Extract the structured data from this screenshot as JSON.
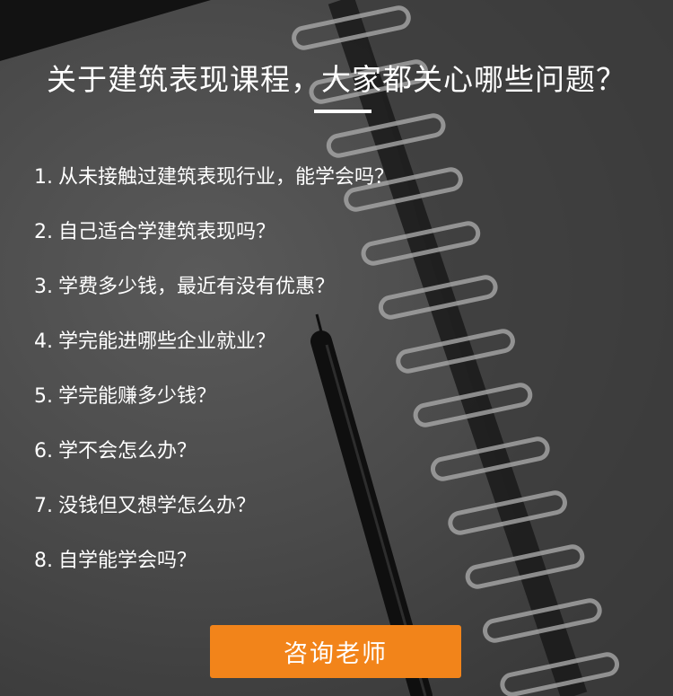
{
  "header": {
    "title": "关于建筑表现课程，大家都关心哪些问题？"
  },
  "faq": {
    "items": [
      {
        "num": "1.",
        "text": "从未接触过建筑表现行业，能学会吗？"
      },
      {
        "num": "2.",
        "text": "自己适合学建筑表现吗？"
      },
      {
        "num": "3.",
        "text": "学费多少钱，最近有没有优惠？"
      },
      {
        "num": "4.",
        "text": "学完能进哪些企业就业？"
      },
      {
        "num": "5.",
        "text": "学完能赚多少钱？"
      },
      {
        "num": "6.",
        "text": "学不会怎么办？"
      },
      {
        "num": "7.",
        "text": "没钱但又想学怎么办？"
      },
      {
        "num": "8.",
        "text": "自学能学会吗？"
      }
    ]
  },
  "cta": {
    "label": "咨询老师"
  },
  "colors": {
    "accent": "#f2841a",
    "text": "#ffffff",
    "background": "#4a4a4a"
  },
  "background_art": {
    "icon": "spiral-notebook-and-pen-photo"
  }
}
